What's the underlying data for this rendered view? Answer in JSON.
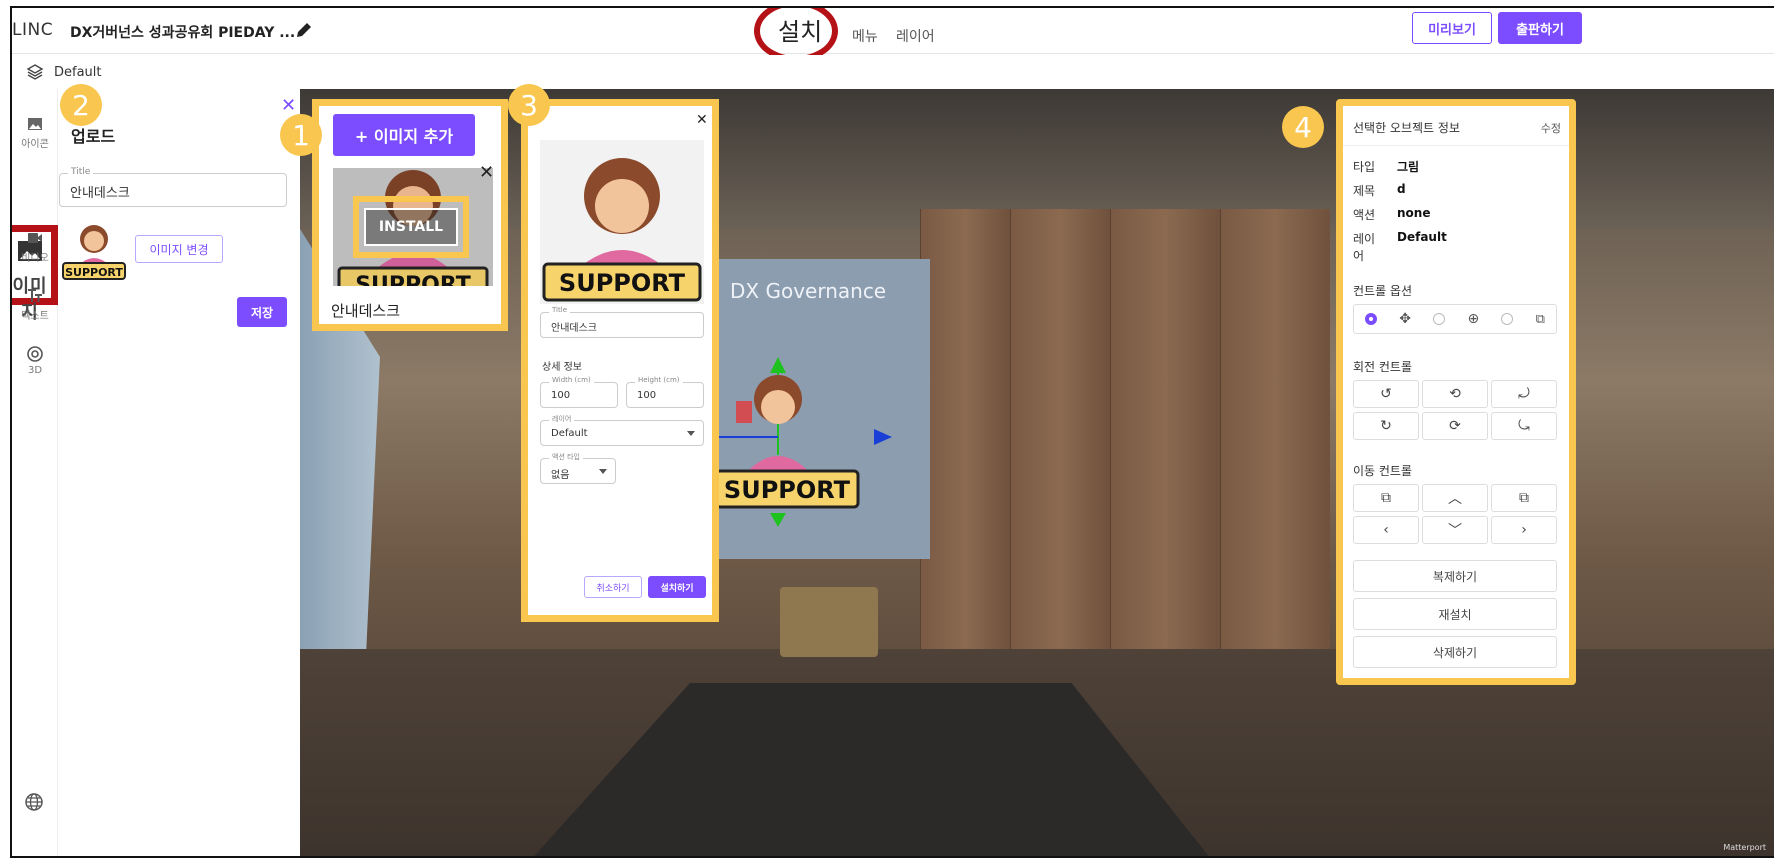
{
  "header": {
    "logo": "LINC",
    "project_title": "DX거버넌스 성과공유회 PIEDAY ...",
    "tabs": [
      "설치",
      "메뉴",
      "레이어"
    ],
    "preview_label": "미리보기",
    "publish_label": "출판하기"
  },
  "layer_bar": {
    "layer_name": "Default"
  },
  "rail": {
    "items": [
      {
        "label": "아이콘",
        "icon": "image-icon"
      },
      {
        "label": "이미지",
        "icon": "image-icon"
      },
      {
        "label": "비디오",
        "icon": "video-icon"
      },
      {
        "label": "텍스트",
        "icon": "text-icon"
      },
      {
        "label": "3D",
        "icon": "cube-icon"
      }
    ],
    "bottom_icon": "globe-icon"
  },
  "upload_panel": {
    "title": "업로드",
    "title_field_label": "Title",
    "title_field_value": "안내데스크",
    "change_image_label": "이미지 변경",
    "save_label": "저장",
    "thumb_text": "SUPPORT"
  },
  "badges": [
    "1",
    "2",
    "3",
    "4"
  ],
  "library_card": {
    "add_image_label": "+ 이미지 추가",
    "install_label": "INSTALL",
    "thumb_text": "SUPPORT",
    "caption": "안내데스크"
  },
  "detail_modal": {
    "image_text": "SUPPORT",
    "title_label": "Title",
    "title_value": "안내데스크",
    "details_heading": "상세 정보",
    "width_label": "Width (cm)",
    "width_value": "100",
    "height_label": "Height (cm)",
    "height_value": "100",
    "layer_label": "레이어",
    "layer_value": "Default",
    "action_label": "액션 타입",
    "action_value": "없음",
    "cancel_label": "취소하기",
    "install_label": "설치하기"
  },
  "scene": {
    "banner_text": "DX Governance",
    "support_text": "SUPPORT"
  },
  "object_info": {
    "title": "선택한 오브젝트 정보",
    "edit_label": "수정",
    "fields": [
      {
        "key": "타입",
        "value": "그림"
      },
      {
        "key": "제목",
        "value": "d"
      },
      {
        "key": "액션",
        "value": "none"
      },
      {
        "key": "레이어",
        "value": "Default"
      }
    ],
    "control_options_title": "컨트롤 옵션",
    "rotation_title": "회전 컨트롤",
    "move_title": "이동 컨트롤",
    "duplicate_label": "복제하기",
    "reinstall_label": "재설치",
    "delete_label": "삭제하기"
  },
  "colors": {
    "accent": "#7c4dff",
    "highlight": "#f9c74f",
    "marker": "#b41216"
  }
}
